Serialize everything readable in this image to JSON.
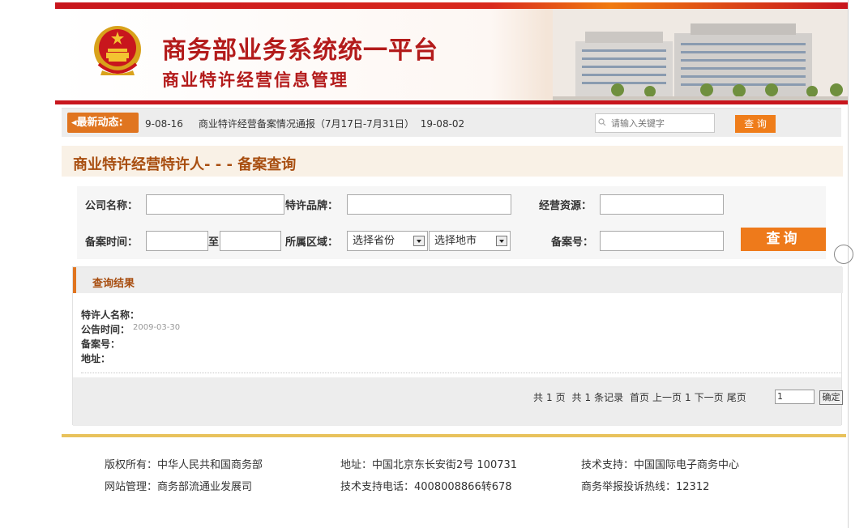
{
  "header": {
    "title_main": "商务部业务系统统一平台",
    "title_sub": "商业特许经营信息管理"
  },
  "news": {
    "label": "最新动态:",
    "items": [
      "9-08-16",
      "商业特许经营备案情况通报（7月17日-7月31日）",
      "19-08-02"
    ],
    "search_placeholder": "请输入关键字",
    "search_button": "查 询"
  },
  "page_title": "商业特许经营特许人- - - 备案查询",
  "form": {
    "company_label": "公司名称：",
    "brand_label": "特许品牌：",
    "resource_label": "经营资源：",
    "date_label": "备案时间：",
    "to_label": "至",
    "region_label": "所属区域：",
    "province_selected": "选择省份",
    "city_selected": "选择地市",
    "record_no_label": "备案号：",
    "query_button": "查询"
  },
  "results": {
    "heading": "查询结果",
    "fields": {
      "name_label": "特许人名称：",
      "date_label": "公告时间：",
      "date_value": "2009-03-30",
      "record_label": "备案号：",
      "address_label": "地址："
    }
  },
  "pager": {
    "total_prefix": "共",
    "total_pages": "1",
    "pages_unit": "页",
    "records_prefix": "共",
    "total_records": "1",
    "records_unit": "条记录",
    "first": "首页",
    "prev": "上一页",
    "current": "1",
    "next": "下一页",
    "last": "尾页",
    "goto_value": "1",
    "confirm": "确定"
  },
  "footer": {
    "copyright": "版权所有：中华人民共和国商务部",
    "address": "地址：中国北京东长安街2号 100731",
    "tech_support": "技术支持：中国国际电子商务中心",
    "site_admin": "网站管理：商务部流通业发展司",
    "tech_phone": "技术支持电话：4008008866转678",
    "hotline": "商务举报投诉热线：12312"
  },
  "colors": {
    "brand_red": "#c8161d",
    "accent_orange": "#ef7d1a",
    "title_brown": "#a84e10",
    "footer_gold": "#e8c25c"
  },
  "icons": [
    "national-emblem",
    "speaker-icon",
    "search-icon",
    "chevron-down-icon"
  ]
}
